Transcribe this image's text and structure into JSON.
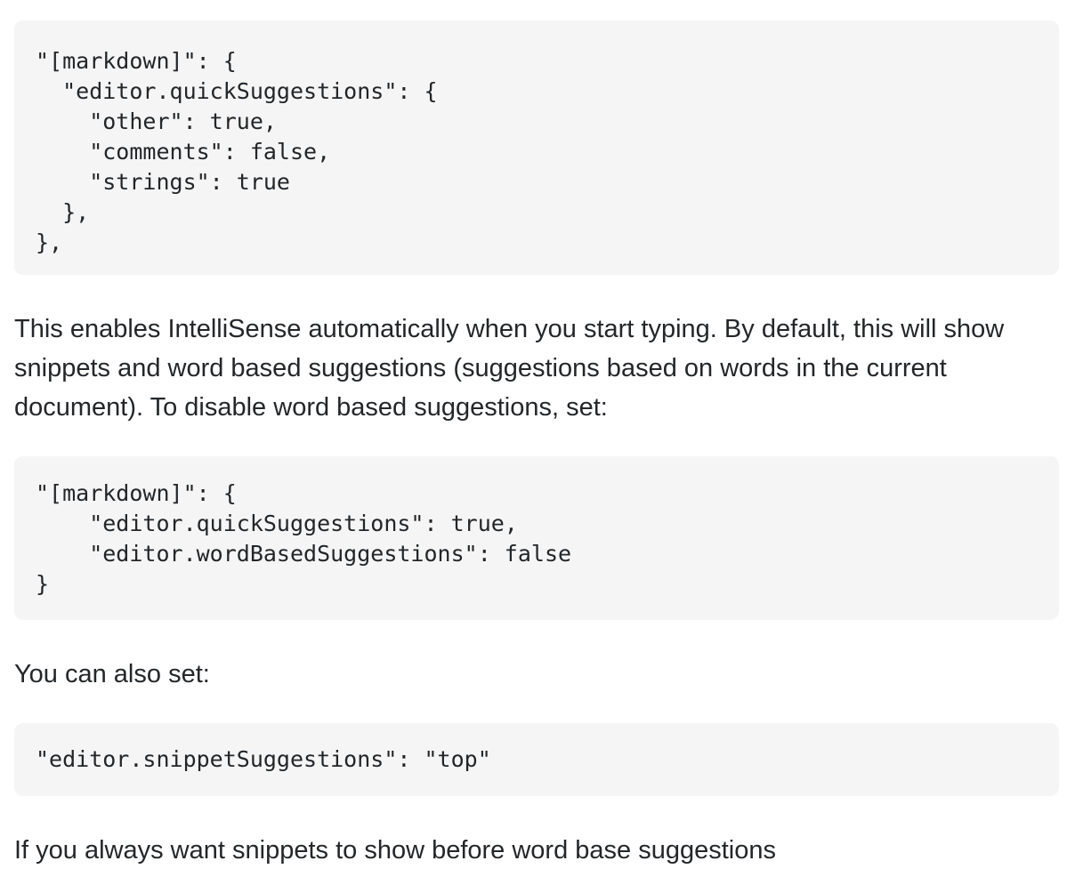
{
  "code_blocks": [
    {
      "text": "\"[markdown]\": {\n  \"editor.quickSuggestions\": {\n    \"other\": true,\n    \"comments\": false,\n    \"strings\": true\n  },\n},"
    },
    {
      "text": "\"[markdown]\": {\n    \"editor.quickSuggestions\": true,\n    \"editor.wordBasedSuggestions\": false\n}"
    },
    {
      "text": "\"editor.snippetSuggestions\": \"top\""
    }
  ],
  "paragraphs": [
    "This enables IntelliSense automatically when you start typing. By default, this will show snippets and word based suggestions (suggestions based on words in the current document). To disable word based suggestions, set:",
    "You can also set:",
    "If you always want snippets to show before word base suggestions"
  ]
}
